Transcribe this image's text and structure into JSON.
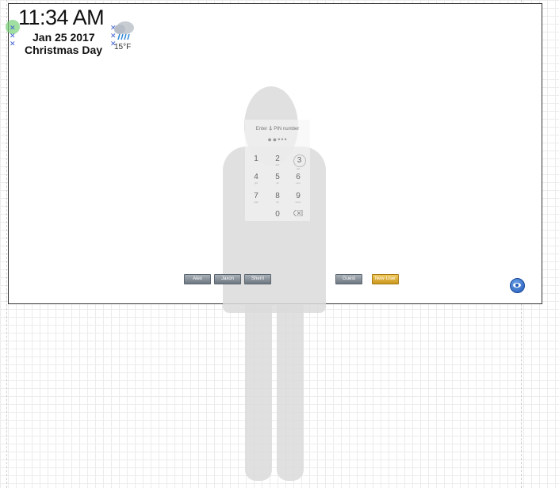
{
  "clock": {
    "time": "11:34 AM",
    "date": "Jan 25 2017",
    "holiday": "Christmas Day"
  },
  "weather": {
    "icon": "rain-cloud-icon",
    "temperature": "15°F"
  },
  "pinpad": {
    "title_left": "Enter",
    "title_right": "PIN number",
    "dots": "●●•••",
    "keys": [
      {
        "digit": "1",
        "letters": ""
      },
      {
        "digit": "2",
        "letters": "abc"
      },
      {
        "digit": "3",
        "letters": "def"
      },
      {
        "digit": "4",
        "letters": "ghi"
      },
      {
        "digit": "5",
        "letters": "jkl"
      },
      {
        "digit": "6",
        "letters": "mno"
      },
      {
        "digit": "7",
        "letters": "pqrs"
      },
      {
        "digit": "8",
        "letters": "tuv"
      },
      {
        "digit": "9",
        "letters": "wxyz"
      },
      {
        "digit": "0",
        "letters": ""
      }
    ],
    "backspace_icon": "backspace-icon"
  },
  "users": [
    "Alex",
    "Jaxon",
    "Sherri"
  ],
  "guest_label": "Guest",
  "new_user_label": "New User",
  "colors": {
    "accent": "#2059b8",
    "gold": "#c9971e",
    "button": "#6d7781"
  }
}
